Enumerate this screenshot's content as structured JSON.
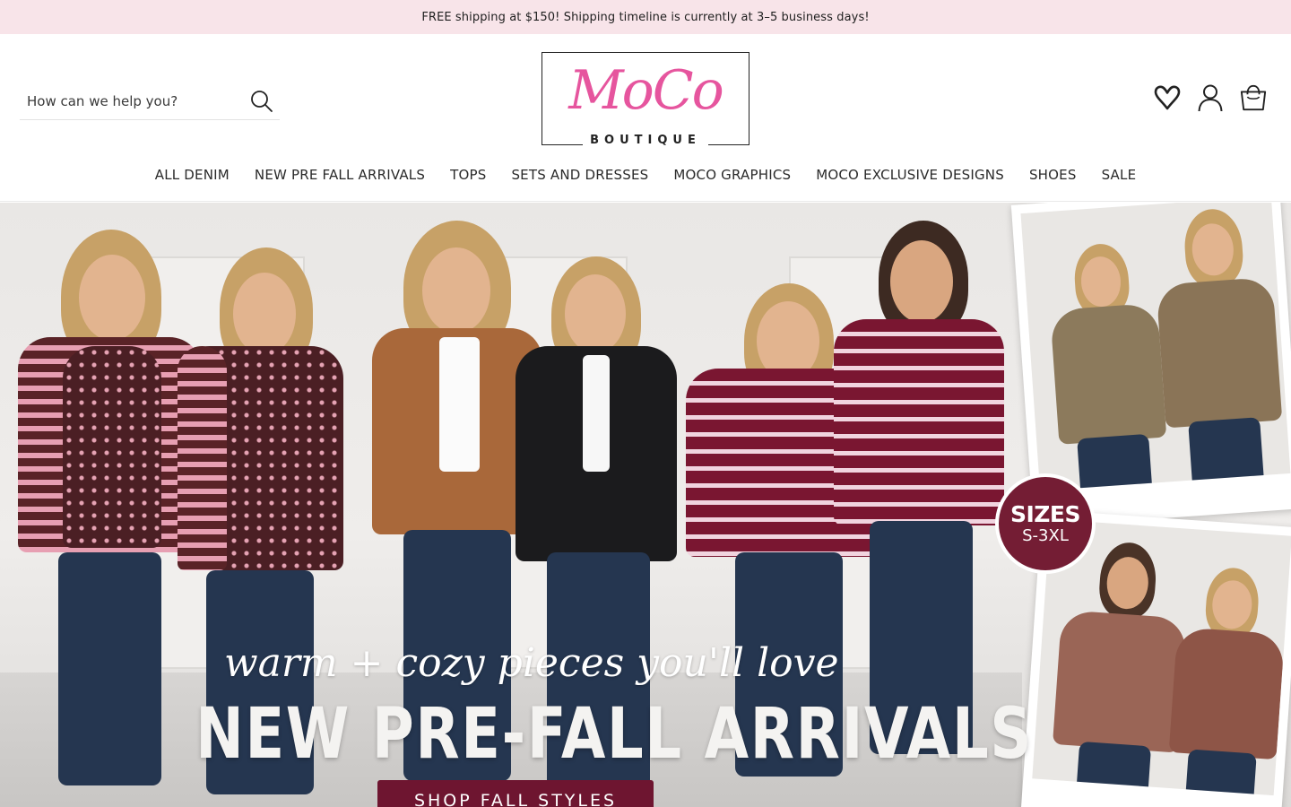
{
  "announcement": {
    "text": "FREE shipping at $150! Shipping timeline is currently at 3–5 business days!"
  },
  "search": {
    "placeholder": "How can we help you?",
    "icon": "search-icon"
  },
  "logo": {
    "main": "MoCo",
    "sub": "BOUTIQUE"
  },
  "header_icons": [
    "wishlist-heart-icon",
    "account-icon",
    "cart-bag-icon"
  ],
  "nav": {
    "items": [
      {
        "label": "ALL DENIM"
      },
      {
        "label": "NEW PRE FALL ARRIVALS"
      },
      {
        "label": "TOPS"
      },
      {
        "label": "SETS AND DRESSES"
      },
      {
        "label": "MOCO GRAPHICS"
      },
      {
        "label": "MOCO EXCLUSIVE DESIGNS"
      },
      {
        "label": "SHOES"
      },
      {
        "label": "SALE"
      }
    ]
  },
  "hero": {
    "script_line": "warm + cozy pieces you'll love",
    "title": "NEW PRE-FALL ARRIVALS",
    "cta": "SHOP FALL STYLES",
    "badge_line1": "SIZES",
    "badge_line2": "S-3XL"
  },
  "colors": {
    "announcement_bg": "#f8e4e9",
    "logo_pink": "#e6559e",
    "cta_bg": "#6e1530",
    "badge_bg": "#741d34"
  }
}
